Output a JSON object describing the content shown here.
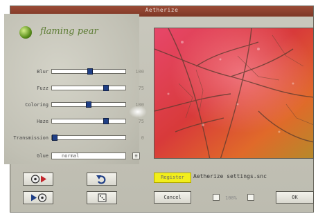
{
  "window": {
    "title": "Aetherize"
  },
  "brand": {
    "name": "flaming pear"
  },
  "sliders": [
    {
      "label": "Blur",
      "value": "100",
      "fraction": 0.52
    },
    {
      "label": "Fuzz",
      "value": "75",
      "fraction": 0.74
    },
    {
      "label": "Coloring",
      "value": "100",
      "fraction": 0.5
    },
    {
      "label": "Haze",
      "value": "75",
      "fraction": 0.74
    },
    {
      "label": "Transmission",
      "value": "0",
      "fraction": 0.04
    }
  ],
  "glue": {
    "label": "Glue",
    "value": "normal",
    "button": "≡"
  },
  "buttons": {
    "register": "Register",
    "settings_file": "Aetherize settings.snc",
    "cancel": "Cancel",
    "zoom_label": "100%",
    "ok": "OK"
  },
  "colors": {
    "accent_red": "#c2262c",
    "accent_blue": "#1f3f86",
    "register_yellow": "#f2ee1c"
  }
}
